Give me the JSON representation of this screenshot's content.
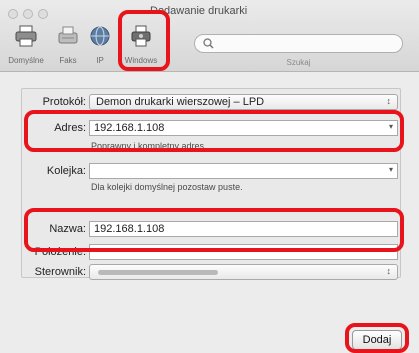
{
  "window": {
    "title": "Dodawanie drukarki"
  },
  "toolbar": {
    "items": [
      {
        "label": "Domyślne",
        "icon": "printer-icon"
      },
      {
        "label": "Faks",
        "icon": "fax-icon"
      },
      {
        "label": "IP",
        "icon": "globe-icon"
      },
      {
        "label": "Windows",
        "icon": "windows-printer-icon"
      }
    ],
    "search": {
      "placeholder": "",
      "label": "Szukaj"
    }
  },
  "form": {
    "protocol": {
      "label": "Protokół:",
      "value": "Demon drukarki wierszowej – LPD"
    },
    "address": {
      "label": "Adres:",
      "value": "192.168.1.108",
      "hint": "Poprawny i kompletny adres."
    },
    "queue": {
      "label": "Kolejka:",
      "value": "",
      "hint": "Dla kolejki domyślnej pozostaw puste."
    },
    "name": {
      "label": "Nazwa:",
      "value": "192.168.1.108"
    },
    "location": {
      "label": "Położenie:",
      "value": ""
    },
    "driver": {
      "label": "Sterownik:",
      "value": ""
    }
  },
  "buttons": {
    "add": "Dodaj"
  },
  "annotations": {
    "color": "#e8141b"
  }
}
